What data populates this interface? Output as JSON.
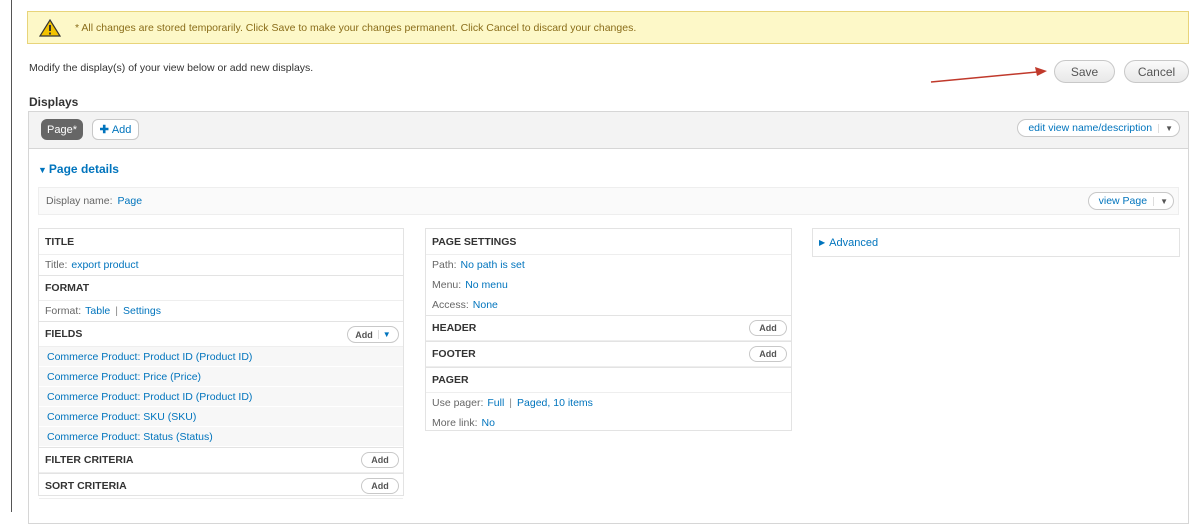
{
  "warning": {
    "icon": "warning-icon",
    "text": "* All changes are stored temporarily. Click Save to make your changes permanent. Click Cancel to discard your changes."
  },
  "intro": "Modify the display(s) of your view below or add new displays.",
  "actions": {
    "save": "Save",
    "cancel": "Cancel"
  },
  "displays": {
    "title": "Displays",
    "tabs": [
      {
        "label": "Page*"
      }
    ],
    "add_label": "Add",
    "edit_view": "edit view name/description"
  },
  "page_details": {
    "toggle": "Page details",
    "display_name_label": "Display name:",
    "display_name_value": "Page",
    "view_page": "view Page"
  },
  "column1": {
    "title_section": {
      "heading": "TITLE",
      "label": "Title:",
      "value": "export product"
    },
    "format_section": {
      "heading": "FORMAT",
      "label": "Format:",
      "value": "Table",
      "settings": "Settings"
    },
    "fields_section": {
      "heading": "FIELDS",
      "add": "Add",
      "items": [
        "Commerce Product: Product ID (Product ID)",
        "Commerce Product: Price (Price)",
        "Commerce Product: Product ID (Product ID)",
        "Commerce Product: SKU (SKU)",
        "Commerce Product: Status (Status)"
      ]
    },
    "filter_section": {
      "heading": "FILTER CRITERIA",
      "add": "Add"
    },
    "sort_section": {
      "heading": "SORT CRITERIA",
      "add": "Add"
    }
  },
  "column2": {
    "page_settings": {
      "heading": "PAGE SETTINGS",
      "path_label": "Path:",
      "path_value": "No path is set",
      "menu_label": "Menu:",
      "menu_value": "No menu",
      "access_label": "Access:",
      "access_value": "None"
    },
    "header_section": {
      "heading": "HEADER",
      "add": "Add"
    },
    "footer_section": {
      "heading": "FOOTER",
      "add": "Add"
    },
    "pager_section": {
      "heading": "PAGER",
      "use_pager_label": "Use pager:",
      "use_pager_value": "Full",
      "paged_value": "Paged, 10 items",
      "more_link_label": "More link:",
      "more_link_value": "No"
    }
  },
  "column3": {
    "advanced": "Advanced"
  },
  "colors": {
    "link": "#0074bd",
    "warning_bg": "#fdf8c8",
    "arrow": "#c0392b"
  }
}
